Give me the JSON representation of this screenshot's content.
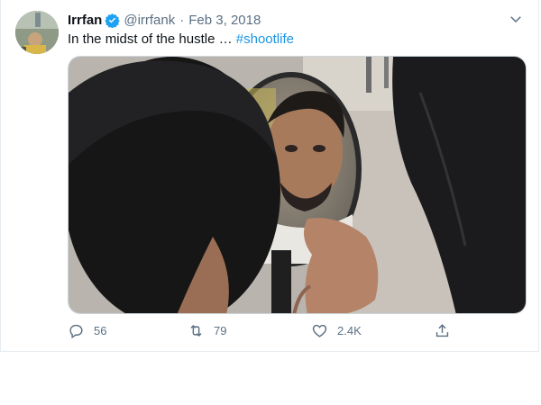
{
  "tweet": {
    "author_name": "Irrfan",
    "handle": "@irrfank",
    "separator": "·",
    "date": "Feb 3, 2018",
    "text": "In the midst of the hustle …",
    "hashtag": "#shootlife"
  },
  "actions": {
    "replies": "56",
    "retweets": "79",
    "likes": "2.4K"
  },
  "colors": {
    "accent": "#1b95e0",
    "verified": "#1da1f2",
    "muted": "#5b7083"
  },
  "icons": {
    "verified": "verified-badge-icon",
    "menu": "chevron-down-icon",
    "reply": "reply-icon",
    "retweet": "retweet-icon",
    "like": "heart-icon",
    "share": "share-icon"
  }
}
